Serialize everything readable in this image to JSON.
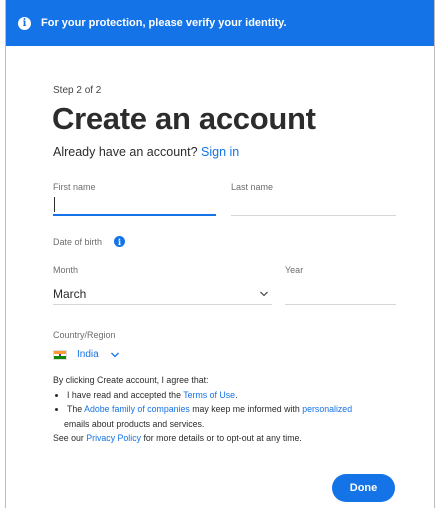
{
  "banner": {
    "text": "For your protection, please verify your identity."
  },
  "step": "Step 2 of 2",
  "title": "Create an account",
  "signin": {
    "prompt": "Already have an account?",
    "link": "Sign in"
  },
  "fields": {
    "first_name_label": "First name",
    "last_name_label": "Last name",
    "dob_label": "Date of birth",
    "month_label": "Month",
    "month_value": "March",
    "year_label": "Year",
    "country_label": "Country/Region",
    "country_value": "India"
  },
  "legal": {
    "intro": "By clicking Create account, I agree that:",
    "b1_pre": "I have read and accepted the ",
    "b1_link": "Terms of Use",
    "b1_post": ".",
    "b2_pre": "The ",
    "b2_link1": "Adobe family of companies",
    "b2_mid": " may keep me informed with ",
    "b2_link2": "personalized",
    "b2_cont": "emails about products and services.",
    "foot_pre": "See our ",
    "foot_link": "Privacy Policy",
    "foot_post": " for more details or to opt-out at any time."
  },
  "done_label": "Done",
  "colors": {
    "accent": "#1473e6"
  }
}
